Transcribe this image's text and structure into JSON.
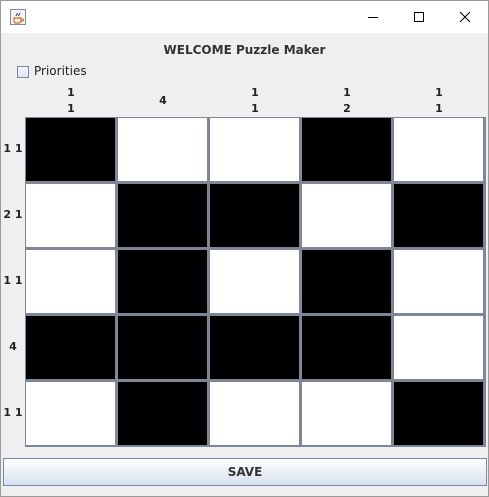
{
  "window": {
    "title": ""
  },
  "header": {
    "title": "WELCOME Puzzle Maker"
  },
  "options": {
    "priorities_label": "Priorities",
    "priorities_checked": false
  },
  "column_clues": [
    [
      "1",
      "1"
    ],
    [
      "4"
    ],
    [
      "1",
      "1"
    ],
    [
      "1",
      "2"
    ],
    [
      "1",
      "1"
    ]
  ],
  "row_clues": [
    "1 1",
    "2 1",
    "1 1",
    "4",
    "1 1"
  ],
  "grid": {
    "rows": [
      [
        1,
        0,
        0,
        1,
        0
      ],
      [
        0,
        1,
        1,
        0,
        1
      ],
      [
        0,
        1,
        0,
        1,
        0
      ],
      [
        1,
        1,
        1,
        1,
        0
      ],
      [
        0,
        1,
        0,
        0,
        1
      ]
    ]
  },
  "actions": {
    "save_label": "SAVE"
  },
  "colors": {
    "filled": "#000000",
    "empty": "#ffffff",
    "grid_line": "#7e8795"
  },
  "icons": {
    "app": "java-coffee-icon",
    "minimize": "minimize-icon",
    "maximize": "maximize-icon",
    "close": "close-icon"
  }
}
